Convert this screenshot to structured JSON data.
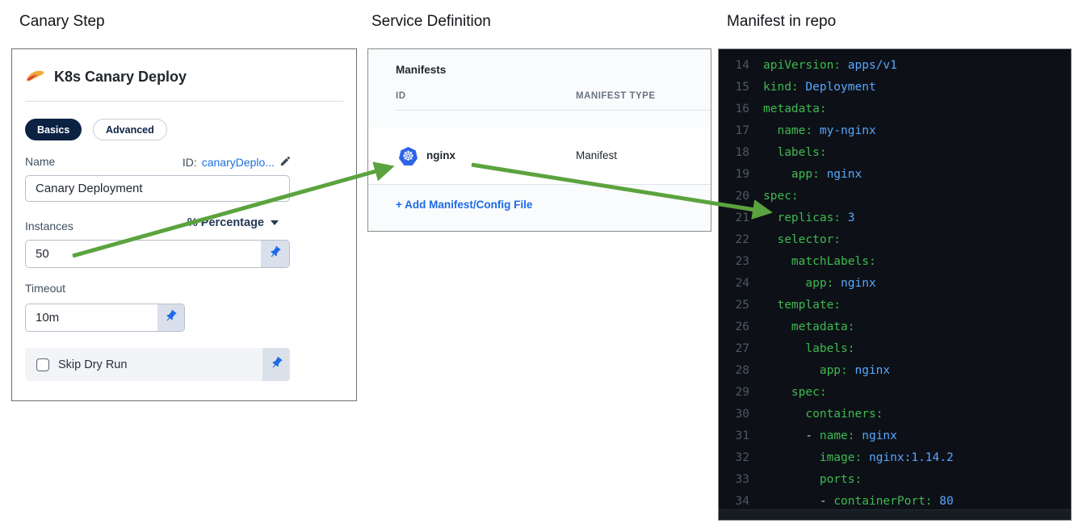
{
  "section_labels": {
    "canary_step": "Canary Step",
    "service_definition": "Service Definition",
    "manifest_in_repo": "Manifest in repo"
  },
  "canary_panel": {
    "title": "K8s Canary Deploy",
    "tabs": [
      {
        "label": "Basics",
        "active": true
      },
      {
        "label": "Advanced",
        "active": false
      }
    ],
    "name_field": {
      "label": "Name",
      "id_prefix": "ID:",
      "id_value": "canaryDeplo...",
      "value": "Canary Deployment"
    },
    "instances_field": {
      "label": "Instances",
      "unit_selector": "% Percentage",
      "value": "50"
    },
    "timeout_field": {
      "label": "Timeout",
      "value": "10m"
    },
    "skip_dry_run": {
      "label": "Skip Dry Run",
      "checked": false
    }
  },
  "service_panel": {
    "title": "Manifests",
    "columns": [
      "ID",
      "MANIFEST TYPE"
    ],
    "rows": [
      {
        "id": "nginx",
        "manifest_type": "Manifest"
      }
    ],
    "add_link": "+ Add Manifest/Config File"
  },
  "code_panel": {
    "language": "yaml",
    "lines": [
      {
        "n": 14,
        "indent": 0,
        "dash": false,
        "key": "apiVersion",
        "value": "apps/v1"
      },
      {
        "n": 15,
        "indent": 0,
        "dash": false,
        "key": "kind",
        "value": "Deployment"
      },
      {
        "n": 16,
        "indent": 0,
        "dash": false,
        "key": "metadata",
        "value": null
      },
      {
        "n": 17,
        "indent": 2,
        "dash": false,
        "key": "name",
        "value": "my-nginx"
      },
      {
        "n": 18,
        "indent": 2,
        "dash": false,
        "key": "labels",
        "value": null
      },
      {
        "n": 19,
        "indent": 4,
        "dash": false,
        "key": "app",
        "value": "nginx"
      },
      {
        "n": 20,
        "indent": 0,
        "dash": false,
        "key": "spec",
        "value": null
      },
      {
        "n": 21,
        "indent": 2,
        "dash": false,
        "key": "replicas",
        "value": "3"
      },
      {
        "n": 22,
        "indent": 2,
        "dash": false,
        "key": "selector",
        "value": null
      },
      {
        "n": 23,
        "indent": 4,
        "dash": false,
        "key": "matchLabels",
        "value": null
      },
      {
        "n": 24,
        "indent": 6,
        "dash": false,
        "key": "app",
        "value": "nginx"
      },
      {
        "n": 25,
        "indent": 2,
        "dash": false,
        "key": "template",
        "value": null
      },
      {
        "n": 26,
        "indent": 4,
        "dash": false,
        "key": "metadata",
        "value": null
      },
      {
        "n": 27,
        "indent": 6,
        "dash": false,
        "key": "labels",
        "value": null
      },
      {
        "n": 28,
        "indent": 8,
        "dash": false,
        "key": "app",
        "value": "nginx"
      },
      {
        "n": 29,
        "indent": 4,
        "dash": false,
        "key": "spec",
        "value": null
      },
      {
        "n": 30,
        "indent": 6,
        "dash": false,
        "key": "containers",
        "value": null
      },
      {
        "n": 31,
        "indent": 6,
        "dash": true,
        "key": "name",
        "value": "nginx"
      },
      {
        "n": 32,
        "indent": 8,
        "dash": false,
        "key": "image",
        "value": "nginx:1.14.2"
      },
      {
        "n": 33,
        "indent": 8,
        "dash": false,
        "key": "ports",
        "value": null
      },
      {
        "n": 34,
        "indent": 8,
        "dash": true,
        "key": "containerPort",
        "value": "80"
      }
    ]
  },
  "icons": {
    "step_icon": "canary-bird-icon",
    "edit_icon": "pencil-icon",
    "pin_icon": "pushpin-icon",
    "manifest_icon": "kubernetes-icon",
    "unit_caret": "chevron-down-icon"
  },
  "colors": {
    "arrow_green": "#5ba33e",
    "accent_blue": "#1a6be8",
    "navy_pill": "#0b2242",
    "kubernetes_blue": "#2f64e7",
    "code_bg": "#0d1117",
    "code_key_green": "#3fb950",
    "code_value_blue": "#58a6ff",
    "code_linenum_gray": "#4e5761"
  }
}
